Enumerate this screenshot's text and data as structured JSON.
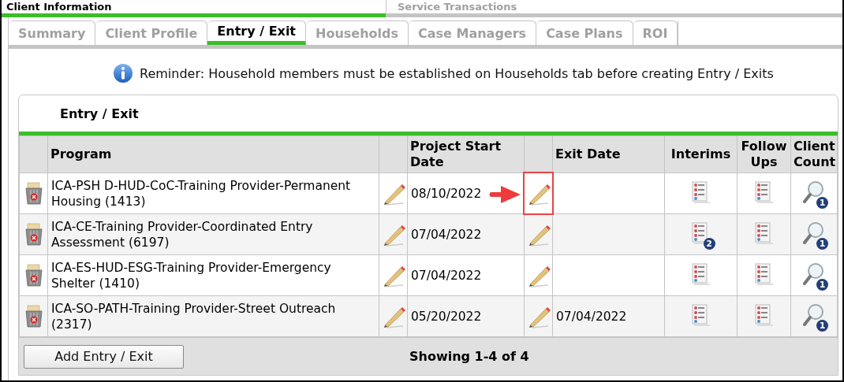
{
  "top_tabs": [
    {
      "label": "Client Information",
      "selected": true
    },
    {
      "label": "Service Transactions",
      "selected": false
    }
  ],
  "tabs": [
    {
      "label": "Summary",
      "selected": false
    },
    {
      "label": "Client Profile",
      "selected": false
    },
    {
      "label": "Entry / Exit",
      "selected": true
    },
    {
      "label": "Households",
      "selected": false
    },
    {
      "label": "Case Managers",
      "selected": false
    },
    {
      "label": "Case Plans",
      "selected": false
    },
    {
      "label": "ROI",
      "selected": false
    }
  ],
  "reminder": "Reminder: Household members must be established on Households tab before creating Entry / Exits",
  "panel": {
    "title": "Entry / Exit",
    "columns": [
      "Program",
      "Project Start Date",
      "Exit Date",
      "Interims",
      "Follow Ups",
      "Client Count"
    ],
    "rows": [
      {
        "program": "ICA-PSH D-HUD-CoC-Training Provider-Permanent Housing (1413)",
        "start_date": "08/10/2022",
        "exit_date": "",
        "interims_badge": "",
        "client_count": "1",
        "exit_edit_highlighted": true
      },
      {
        "program": "ICA-CE-Training Provider-Coordinated Entry Assessment (6197)",
        "start_date": "07/04/2022",
        "exit_date": "",
        "interims_badge": "2",
        "client_count": "1",
        "exit_edit_highlighted": false
      },
      {
        "program": "ICA-ES-HUD-ESG-Training Provider-Emergency Shelter (1410)",
        "start_date": "07/04/2022",
        "exit_date": "",
        "interims_badge": "",
        "client_count": "1",
        "exit_edit_highlighted": false
      },
      {
        "program": "ICA-SO-PATH-Training Provider-Street Outreach (2317)",
        "start_date": "05/20/2022",
        "exit_date": "07/04/2022",
        "interims_badge": "",
        "client_count": "1",
        "exit_edit_highlighted": false
      }
    ],
    "add_button": "Add Entry / Exit",
    "showing": "Showing 1-4 of 4"
  }
}
